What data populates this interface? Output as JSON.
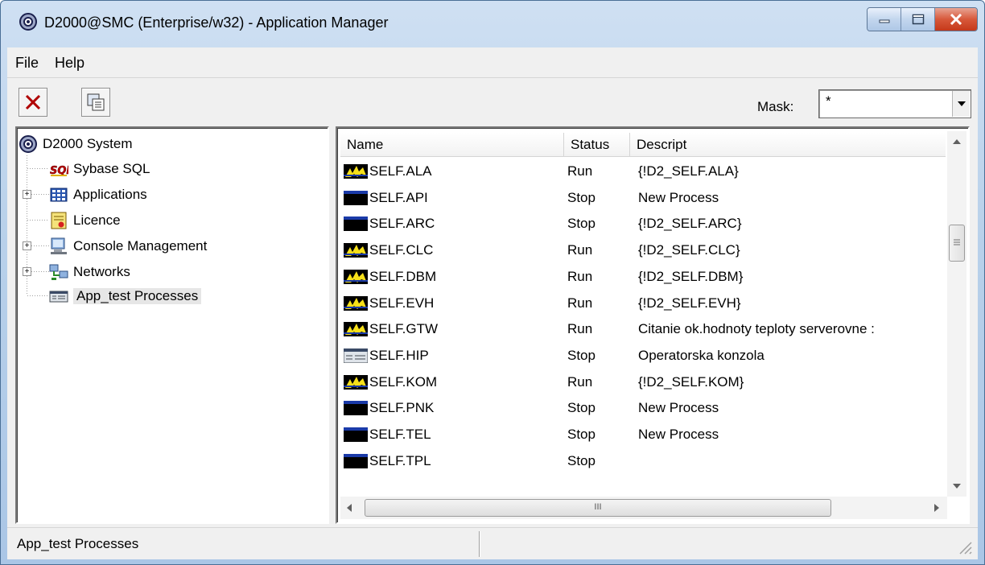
{
  "window": {
    "title": "D2000@SMC (Enterprise/w32) - Application Manager"
  },
  "menu": {
    "items": [
      "File",
      "Help"
    ]
  },
  "toolbar": {
    "mask_label": "Mask:",
    "mask_value": "*"
  },
  "tree": {
    "root": "D2000 System",
    "items": [
      {
        "label": "Sybase SQL",
        "icon": "sql-icon",
        "expandable": false
      },
      {
        "label": "Applications",
        "icon": "applications-icon",
        "expandable": true
      },
      {
        "label": "Licence",
        "icon": "licence-icon",
        "expandable": false
      },
      {
        "label": "Console Management",
        "icon": "console-icon",
        "expandable": true
      },
      {
        "label": "Networks",
        "icon": "network-icon",
        "expandable": true
      },
      {
        "label": "App_test  Processes",
        "icon": "processes-icon",
        "expandable": false,
        "selected": true
      }
    ]
  },
  "list": {
    "columns": [
      "Name",
      "Status",
      "Descript"
    ],
    "rows": [
      {
        "name": "SELF.ALA",
        "status": "Run",
        "descript": "{!D2_SELF.ALA}",
        "icon": "running-process-icon"
      },
      {
        "name": "SELF.API",
        "status": "Stop",
        "descript": "New Process",
        "icon": "stopped-process-icon"
      },
      {
        "name": "SELF.ARC",
        "status": "Stop",
        "descript": "{!D2_SELF.ARC}",
        "icon": "stopped-process-icon"
      },
      {
        "name": "SELF.CLC",
        "status": "Run",
        "descript": "{!D2_SELF.CLC}",
        "icon": "running-process-icon"
      },
      {
        "name": "SELF.DBM",
        "status": "Run",
        "descript": "{!D2_SELF.DBM}",
        "icon": "running-process-icon"
      },
      {
        "name": "SELF.EVH",
        "status": "Run",
        "descript": "{!D2_SELF.EVH}",
        "icon": "running-process-icon"
      },
      {
        "name": "SELF.GTW",
        "status": "Run",
        "descript": "Citanie ok.hodnoty teploty serverovne :",
        "icon": "running-process-icon"
      },
      {
        "name": "SELF.HIP",
        "status": "Stop",
        "descript": "Operatorska konzola",
        "icon": "hip-process-icon"
      },
      {
        "name": "SELF.KOM",
        "status": "Run",
        "descript": "{!D2_SELF.KOM}",
        "icon": "running-process-icon"
      },
      {
        "name": "SELF.PNK",
        "status": "Stop",
        "descript": "New Process",
        "icon": "stopped-process-icon"
      },
      {
        "name": "SELF.TEL",
        "status": "Stop",
        "descript": "New Process",
        "icon": "stopped-process-icon"
      },
      {
        "name": "SELF.TPL",
        "status": "Stop",
        "descript": "",
        "icon": "stopped-process-icon"
      }
    ]
  },
  "scroll": {
    "hthumb_glyph": "III"
  },
  "statusbar": {
    "text": "App_test  Processes"
  }
}
